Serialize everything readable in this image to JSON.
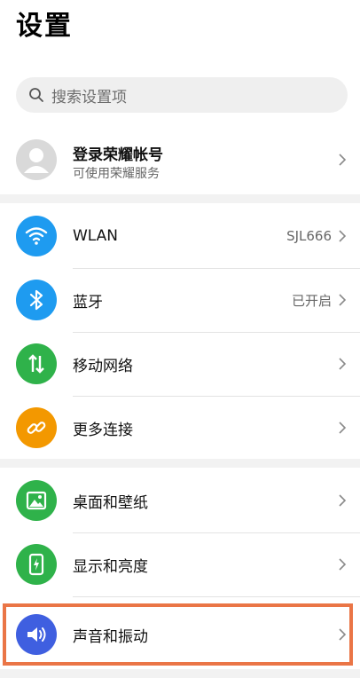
{
  "header": {
    "title": "设置"
  },
  "search": {
    "placeholder": "搜索设置项",
    "icon": "search-icon"
  },
  "account": {
    "name": "登录荣耀帐号",
    "subtitle": "可使用荣耀服务",
    "icon": "avatar-icon"
  },
  "items": [
    {
      "label": "WLAN",
      "value": "SJL666",
      "icon": "wifi-icon",
      "color": "#1e9bf0"
    },
    {
      "label": "蓝牙",
      "value": "已开启",
      "icon": "bluetooth-icon",
      "color": "#1e9bf0"
    },
    {
      "label": "移动网络",
      "value": "",
      "icon": "mobile-data-icon",
      "color": "#2fb24a"
    },
    {
      "label": "更多连接",
      "value": "",
      "icon": "link-icon",
      "color": "#f39800"
    },
    {
      "label": "桌面和壁纸",
      "value": "",
      "icon": "wallpaper-icon",
      "color": "#2fb24a"
    },
    {
      "label": "显示和亮度",
      "value": "",
      "icon": "display-icon",
      "color": "#2fb24a"
    },
    {
      "label": "声音和振动",
      "value": "",
      "icon": "sound-icon",
      "color": "#3f5fe0"
    }
  ],
  "highlight_color": "#ea7546"
}
